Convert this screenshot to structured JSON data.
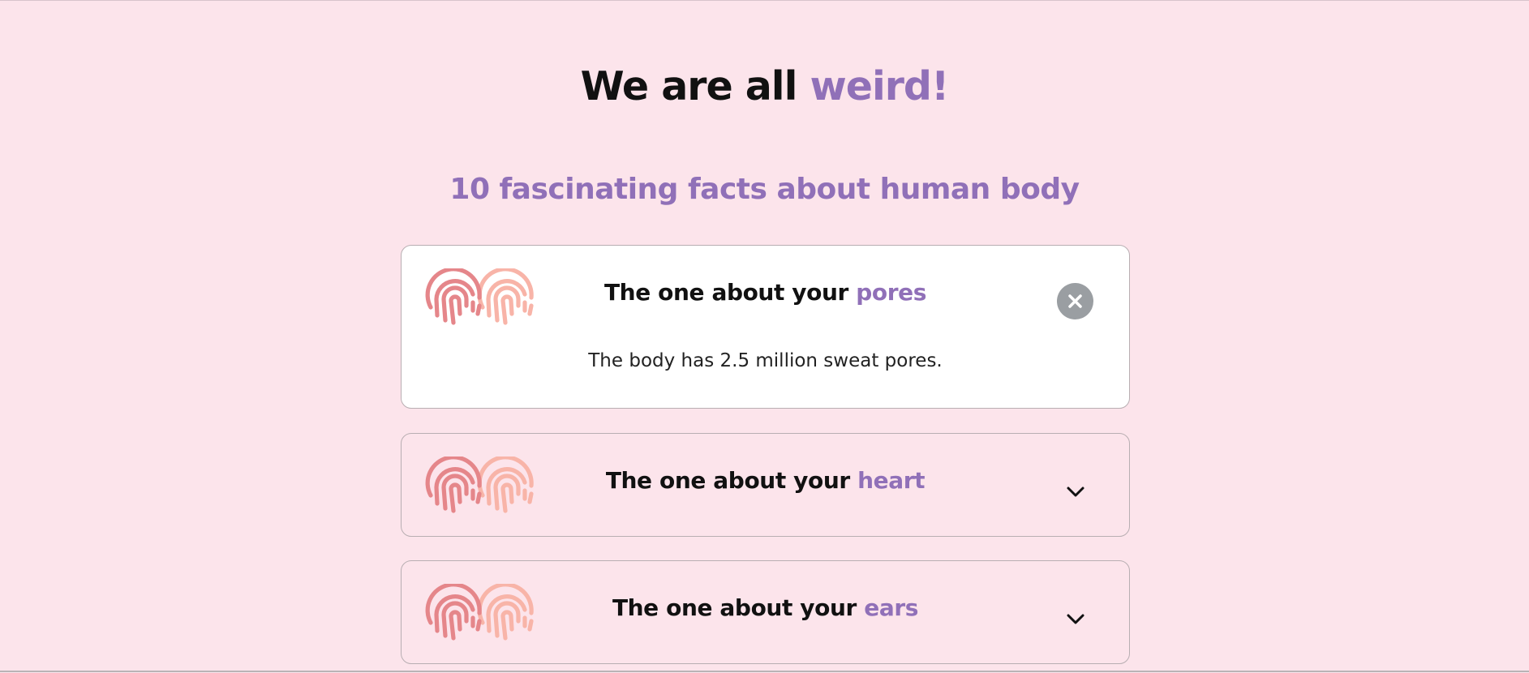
{
  "header": {
    "title_prefix": "We are all",
    "title_accent": "weird!",
    "subtitle": "10 fascinating facts about human body"
  },
  "facts": [
    {
      "title_prefix": "The one about your",
      "topic": "pores",
      "answer": "The body has 2.5 million sweat pores.",
      "expanded": true,
      "toggle_icon": "close-icon"
    },
    {
      "title_prefix": "The one about your",
      "topic": "heart",
      "expanded": false,
      "toggle_icon": "chevron-down-icon"
    },
    {
      "title_prefix": "The one about your",
      "topic": "ears",
      "expanded": false,
      "toggle_icon": "chevron-down-icon"
    }
  ],
  "icons": {
    "fact_icon": "fingerprint-icon"
  },
  "colors": {
    "background": "#fce4eb",
    "accent": "#9070b8",
    "card_open": "#ffffff",
    "fingerprint_dark": "#e5868a",
    "fingerprint_light": "#f8b4a8",
    "close_button": "#9a9ea2"
  }
}
